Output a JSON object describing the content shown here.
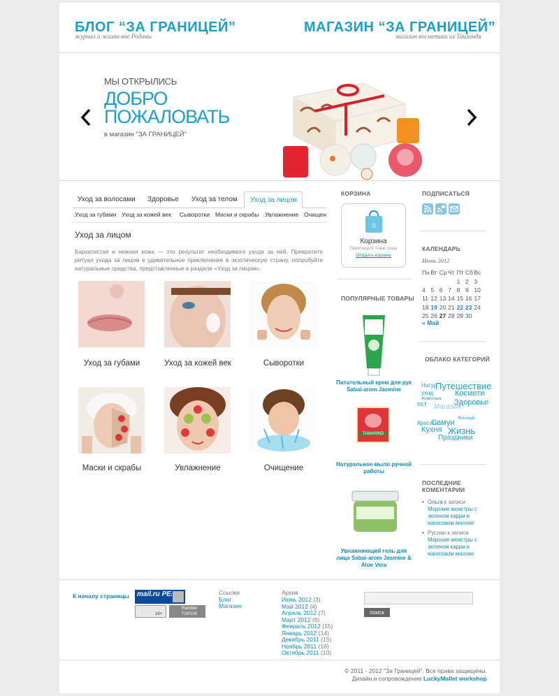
{
  "header": {
    "blog_title": "БЛОГ “ЗА ГРАНИЦЕЙ”",
    "blog_tagline": "журнал о жизни вне Родины",
    "shop_title": "МАГАЗИН “ЗА ГРАНИЦЕЙ”",
    "shop_tagline": "магазин косметики из Таиланда"
  },
  "slider": {
    "line1": "МЫ ОТКРЫЛИСЬ",
    "line2": "ДОБРО",
    "line3": "ПОЖАЛОВАТЬ",
    "line4": "в магазин \"ЗА ГРАНИЦЕЙ\"",
    "prev_icon": "chevron-left-icon",
    "next_icon": "chevron-right-icon"
  },
  "tabs": [
    "Уход за волосами",
    "Здоровье",
    "Уход за телом",
    "Уход за лицом"
  ],
  "subtabs": [
    "Уход за губами",
    "Уход за кожей век",
    "Сыворотки",
    "Маски и скрабы",
    "Увлажнение",
    "Очищени"
  ],
  "section": {
    "title": "Уход за лицом",
    "text": "Бархатистая и нежная кожа — это результат необходимого ухода за ней. Превратите ритуал ухода за лицом в удивительное приключение в экзотическую страну, попробуйте натуральные средства, представленные в разделе «Уход за лицом»."
  },
  "tiles": [
    "Уход за губами",
    "Уход за кожей век",
    "Сыворотки",
    "Маски и скрабы",
    "Увлажнение",
    "Очищение"
  ],
  "cart": {
    "heading": "КОРЗИНА",
    "count": "0",
    "title": "Корзина",
    "hint": "Перетащите товар сюда",
    "link": "Открыть корзину"
  },
  "popular": {
    "heading": "ПОПУЛЯРНЫЕ ТОВАРЫ",
    "items": [
      "Питательный крем для рук Sabai-arom Jasmine",
      "Натуральное мыло ручной работы",
      "Увлажняющий гель для лица Sabai-arom Jasmine & Aloe Vera"
    ],
    "soap_label": "TAMARIND"
  },
  "subscribe": {
    "heading": "ПОДПИСАТЬСЯ"
  },
  "calendar": {
    "heading": "КАЛЕНДАРЬ",
    "month": "Июнь 2012",
    "weekdays": [
      "Пн",
      "Вт",
      "Ср",
      "Чт",
      "Пт",
      "Сб",
      "Вс"
    ],
    "weeks": [
      [
        "",
        "",
        "",
        "",
        "1",
        "2",
        "3"
      ],
      [
        "4",
        "5",
        "6",
        "7",
        "8",
        "9",
        "10"
      ],
      [
        "11",
        "12",
        "13",
        "14",
        "15",
        "16",
        "17"
      ],
      [
        "18",
        "19",
        "20",
        "21",
        "22",
        "23",
        "24"
      ],
      [
        "25",
        "26",
        "27",
        "28",
        "29",
        "30",
        ""
      ]
    ],
    "prev": "« Май"
  },
  "tagcloud": {
    "heading": "ОБЛАКО КАТЕГОРИЙ",
    "tags": [
      "Натур",
      "Путешествие",
      "уход",
      "Космети",
      "Животные",
      "ост",
      "Магазин",
      "Здоровье",
      "Фэн-шуй",
      "Красота",
      "Самуи",
      "Кухня",
      "Жизнь",
      "Праздники"
    ]
  },
  "comments": {
    "heading": "ПОСЛЕДНИЕ КОМЕНТАРИИ",
    "items": [
      {
        "author": "Ольга",
        "sep": " к записи ",
        "post": "Морские монстры с зеленом карри и кокосовом молоке"
      },
      {
        "author": "Руслан",
        "sep": " к записи ",
        "post": "Морские монстры с зеленом карри и кокосовом молоке"
      }
    ]
  },
  "footer": {
    "top_link": "К началу страницы",
    "counter1": "mail.ru РЕЙТИНГ",
    "counter2": "Rambler TOP100",
    "counter_age": "16+",
    "links_heading": "Ссылки",
    "links": [
      "Блог",
      "Магазин"
    ],
    "archive_heading": "Архив",
    "archive": [
      {
        "month": "Июнь 2012",
        "count": "(3)"
      },
      {
        "month": "Май 2012",
        "count": "(4)"
      },
      {
        "month": "Апрель 2012",
        "count": "(7)"
      },
      {
        "month": "Март 2012",
        "count": "(6)"
      },
      {
        "month": "Февраль 2012",
        "count": "(15)"
      },
      {
        "month": "Январь 2012",
        "count": "(14)"
      },
      {
        "month": "Декабрь 2011",
        "count": "(15)"
      },
      {
        "month": "Ноябрь 2011",
        "count": "(16)"
      },
      {
        "month": "Октябрь 2011",
        "count": "(10)"
      }
    ],
    "search_button": "поиск",
    "copyright": "© 2011 - 2012 \"За Границей\". Все права защищены.",
    "credit_prefix": "Дизайн и сопровождение ",
    "credit_link": "LuckyMallet workshop"
  },
  "colors": {
    "accent": "#1a9fc8",
    "link": "#0f8bbd"
  }
}
